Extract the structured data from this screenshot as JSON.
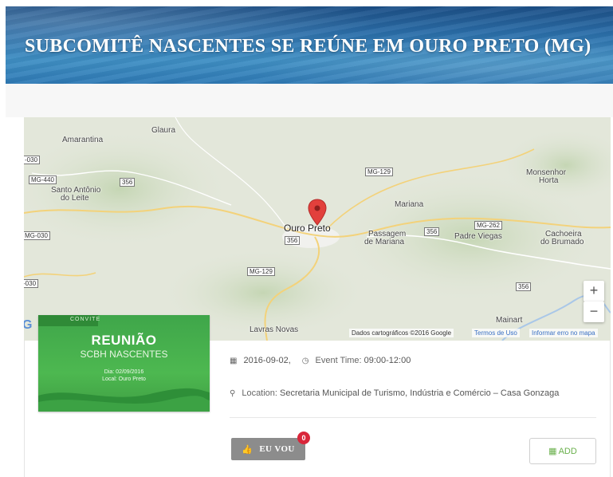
{
  "header": {
    "title": "SUBCOMITÊ NASCENTES SE REÚNE EM OURO PRETO (MG)"
  },
  "map": {
    "places": [
      {
        "label": "Amarantina",
        "big": false
      },
      {
        "label": "Glaura",
        "big": false
      },
      {
        "label": "Santo Antônio",
        "big": false
      },
      {
        "label": "do Leite",
        "big": false
      },
      {
        "label": "Mariana",
        "big": false
      },
      {
        "label": "Monsenhor",
        "big": false
      },
      {
        "label": "Horta",
        "big": false
      },
      {
        "label": "Ouro Preto",
        "big": true
      },
      {
        "label": "Passagem",
        "big": false
      },
      {
        "label": "de Mariana",
        "big": false
      },
      {
        "label": "Padre Viegas",
        "big": false
      },
      {
        "label": "Cachoeira",
        "big": false
      },
      {
        "label": "do Brumado",
        "big": false
      },
      {
        "label": "Lavras Novas",
        "big": false
      },
      {
        "label": "Mainart",
        "big": false
      }
    ],
    "roads": [
      "-030",
      "MG-440",
      "356",
      "MG-129",
      "MG-262",
      "356",
      "MG-030",
      "356",
      "MG-129",
      "356",
      "-030"
    ],
    "zoom_in": "+",
    "zoom_out": "−",
    "attribution": "Dados cartográficos ©2016 Google",
    "terms": "Termos de Uso",
    "report": "Informar erro no mapa"
  },
  "poster": {
    "tag": "CONVITE",
    "title": "REUNIÃO",
    "subtitle": "SCBH NASCENTES",
    "date_line": "Dia: 02/09/2016",
    "place_line": "Local: Ouro Preto"
  },
  "event": {
    "date": "2016-09-02,",
    "time_label": "Event Time:",
    "time": "09:00-12:00",
    "location_label": "Location:",
    "location": "Secretaria Municipal de Turismo, Indústria e Comércio – Casa Gonzaga"
  },
  "actions": {
    "euvou_label": "EU VOU",
    "euvou_count": "0",
    "add_label": "ADD"
  },
  "colors": {
    "accent_green": "#6ab04c",
    "badge_red": "#d9263a",
    "marker_red": "#e2403c"
  }
}
